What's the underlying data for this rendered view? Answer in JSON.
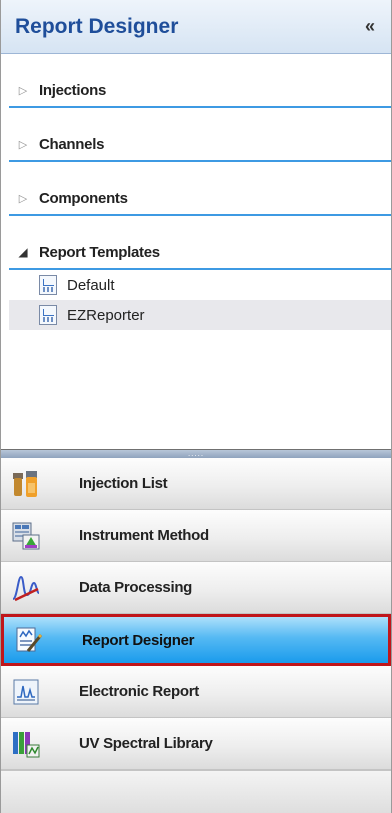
{
  "header": {
    "title": "Report Designer",
    "collapse_glyph": "«"
  },
  "tree": {
    "groups": [
      {
        "label": "Injections",
        "expanded": false
      },
      {
        "label": "Channels",
        "expanded": false
      },
      {
        "label": "Components",
        "expanded": false
      },
      {
        "label": "Report Templates",
        "expanded": true
      }
    ],
    "templates": [
      {
        "label": "Default",
        "icon": "report-template-icon"
      },
      {
        "label": "EZReporter",
        "icon": "report-template-icon",
        "selected": true
      }
    ]
  },
  "splitter": {
    "grip": "....."
  },
  "nav": [
    {
      "label": "Injection List",
      "icon": "injection-list-icon"
    },
    {
      "label": "Instrument Method",
      "icon": "instrument-method-icon"
    },
    {
      "label": "Data Processing",
      "icon": "data-processing-icon"
    },
    {
      "label": "Report Designer",
      "icon": "report-designer-icon",
      "active": true
    },
    {
      "label": "Electronic Report",
      "icon": "electronic-report-icon"
    },
    {
      "label": "UV Spectral Library",
      "icon": "uv-spectral-library-icon"
    }
  ],
  "colors": {
    "accent_blue": "#1f4e9a",
    "rule_blue": "#3d9ae3",
    "active_border": "#c0161b",
    "active_fill": "#1a9bec"
  }
}
